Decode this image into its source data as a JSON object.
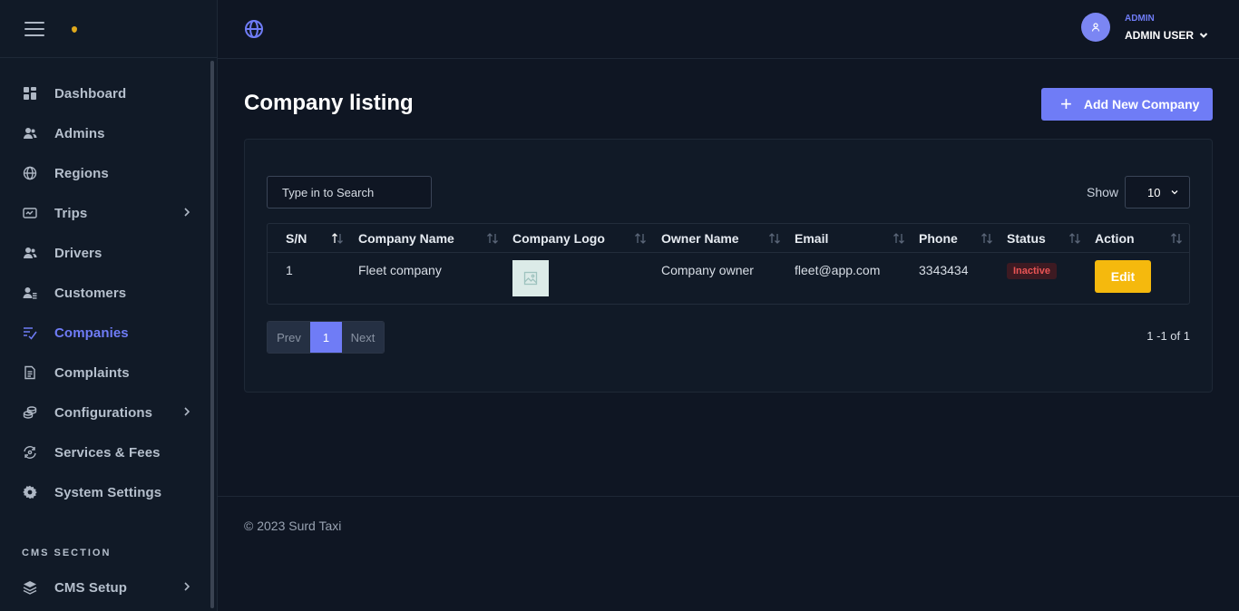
{
  "sidebar": {
    "items": [
      {
        "label": "Dashboard",
        "icon": "dashboard-icon"
      },
      {
        "label": "Admins",
        "icon": "users-icon"
      },
      {
        "label": "Regions",
        "icon": "globe-icon"
      },
      {
        "label": "Trips",
        "icon": "trips-icon",
        "has_submenu": true
      },
      {
        "label": "Drivers",
        "icon": "users-icon"
      },
      {
        "label": "Customers",
        "icon": "customers-icon"
      },
      {
        "label": "Companies",
        "icon": "companies-icon",
        "active": true
      },
      {
        "label": "Complaints",
        "icon": "document-icon"
      },
      {
        "label": "Configurations",
        "icon": "coins-icon",
        "has_submenu": true
      },
      {
        "label": "Services & Fees",
        "icon": "exchange-icon"
      },
      {
        "label": "System Settings",
        "icon": "gear-icon"
      }
    ],
    "cms_title": "CMS SECTION",
    "cms_items": [
      {
        "label": "CMS Setup",
        "icon": "layers-icon",
        "has_submenu": true
      }
    ],
    "accent_color": "#6f7cf6"
  },
  "topbar": {
    "user_role": "ADMIN",
    "user_name": "ADMIN USER"
  },
  "main": {
    "title": "Company listing",
    "add_button_label": "Add New Company",
    "search_placeholder": "Type in to Search",
    "show_label": "Show",
    "page_size": "10",
    "table": {
      "columns": [
        "S/N",
        "Company Name",
        "Company Logo",
        "Owner Name",
        "Email",
        "Phone",
        "Status",
        "Action"
      ],
      "rows": [
        {
          "sn": "1",
          "company_name": "Fleet company",
          "logo": "image-placeholder-icon",
          "owner_name": "Company owner",
          "email": "fleet@app.com",
          "phone": "3343434",
          "status": "Inactive",
          "action": "Edit"
        }
      ]
    },
    "pagination": {
      "prev": "Prev",
      "current": "1",
      "next": "Next",
      "count_text": "1 -1 of 1"
    }
  },
  "footer": {
    "copyright": "© 2023 Surd Taxi"
  }
}
